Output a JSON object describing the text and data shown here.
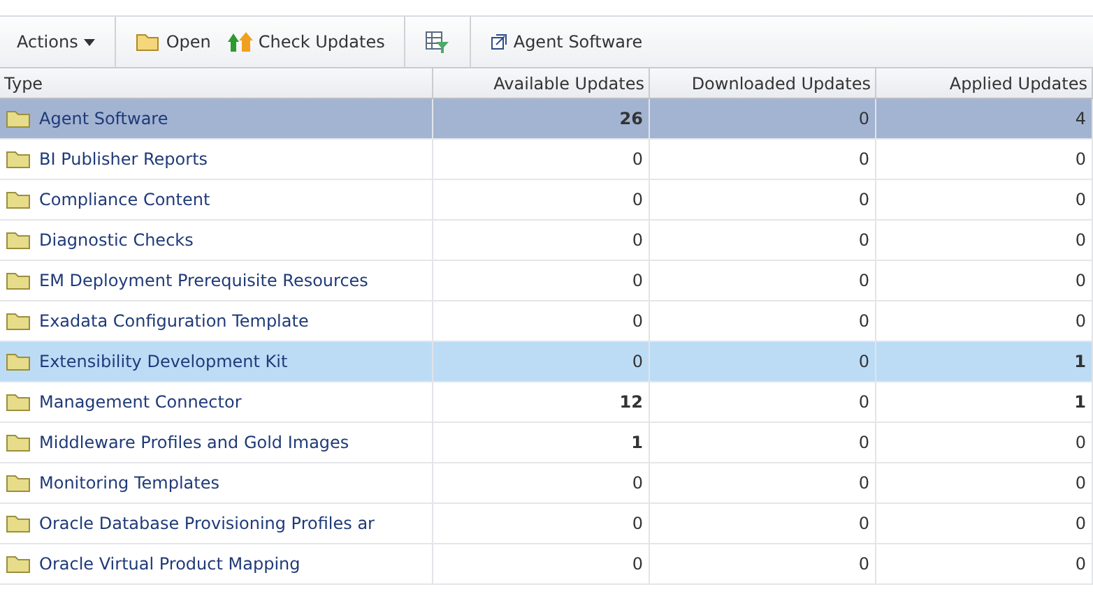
{
  "toolbar": {
    "actions": "Actions",
    "buttons": [
      {
        "kind": "open",
        "label": "Open"
      },
      {
        "kind": "check",
        "label": "Check Updates"
      },
      {
        "kind": "filter"
      },
      {
        "kind": "detach",
        "label": "Agent Software"
      }
    ]
  },
  "table": {
    "columns": [
      "Type",
      "Available Updates",
      "Downloaded Updates",
      "Applied Updates"
    ],
    "rows": [
      {
        "type": "Agent Software",
        "selected": true,
        "hovered": false,
        "available": {
          "value": "26",
          "bold": true
        },
        "downloaded": {
          "value": "0",
          "bold": false
        },
        "applied": {
          "value": "4",
          "bold": false
        }
      },
      {
        "type": "BI Publisher Reports",
        "selected": false,
        "hovered": false,
        "available": {
          "value": "0",
          "bold": false
        },
        "downloaded": {
          "value": "0",
          "bold": false
        },
        "applied": {
          "value": "0",
          "bold": false
        }
      },
      {
        "type": "Compliance Content",
        "selected": false,
        "hovered": false,
        "available": {
          "value": "0",
          "bold": false
        },
        "downloaded": {
          "value": "0",
          "bold": false
        },
        "applied": {
          "value": "0",
          "bold": false
        }
      },
      {
        "type": "Diagnostic Checks",
        "selected": false,
        "hovered": false,
        "available": {
          "value": "0",
          "bold": false
        },
        "downloaded": {
          "value": "0",
          "bold": false
        },
        "applied": {
          "value": "0",
          "bold": false
        }
      },
      {
        "type": "EM Deployment Prerequisite Resources",
        "selected": false,
        "hovered": false,
        "available": {
          "value": "0",
          "bold": false
        },
        "downloaded": {
          "value": "0",
          "bold": false
        },
        "applied": {
          "value": "0",
          "bold": false
        }
      },
      {
        "type": "Exadata Configuration Template",
        "selected": false,
        "hovered": false,
        "available": {
          "value": "0",
          "bold": false
        },
        "downloaded": {
          "value": "0",
          "bold": false
        },
        "applied": {
          "value": "0",
          "bold": false
        }
      },
      {
        "type": "Extensibility Development Kit",
        "selected": false,
        "hovered": true,
        "available": {
          "value": "0",
          "bold": false
        },
        "downloaded": {
          "value": "0",
          "bold": false
        },
        "applied": {
          "value": "1",
          "bold": true
        }
      },
      {
        "type": "Management Connector",
        "selected": false,
        "hovered": false,
        "available": {
          "value": "12",
          "bold": true
        },
        "downloaded": {
          "value": "0",
          "bold": false
        },
        "applied": {
          "value": "1",
          "bold": true
        }
      },
      {
        "type": "Middleware Profiles and Gold Images",
        "selected": false,
        "hovered": false,
        "available": {
          "value": "1",
          "bold": true
        },
        "downloaded": {
          "value": "0",
          "bold": false
        },
        "applied": {
          "value": "0",
          "bold": false
        }
      },
      {
        "type": "Monitoring Templates",
        "selected": false,
        "hovered": false,
        "available": {
          "value": "0",
          "bold": false
        },
        "downloaded": {
          "value": "0",
          "bold": false
        },
        "applied": {
          "value": "0",
          "bold": false
        }
      },
      {
        "type": "Oracle Database Provisioning Profiles ar",
        "selected": false,
        "hovered": false,
        "available": {
          "value": "0",
          "bold": false
        },
        "downloaded": {
          "value": "0",
          "bold": false
        },
        "applied": {
          "value": "0",
          "bold": false
        }
      },
      {
        "type": "Oracle Virtual Product Mapping",
        "selected": false,
        "hovered": false,
        "available": {
          "value": "0",
          "bold": false
        },
        "downloaded": {
          "value": "0",
          "bold": false
        },
        "applied": {
          "value": "0",
          "bold": false
        }
      }
    ]
  }
}
